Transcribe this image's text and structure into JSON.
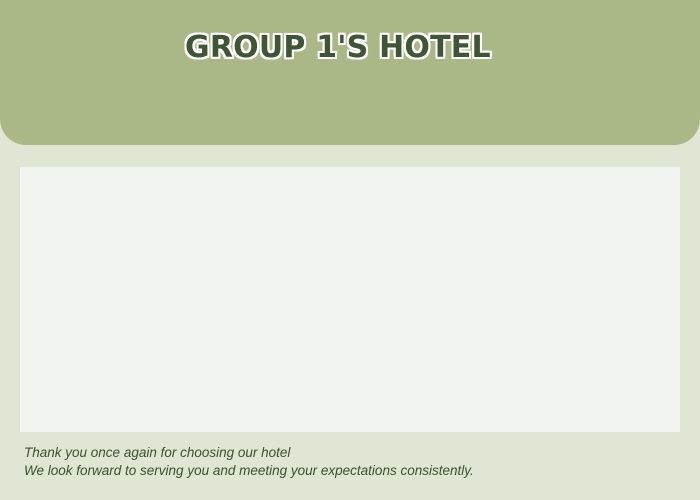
{
  "header": {
    "title": "GROUP 1'S HOTEL"
  },
  "footer": {
    "line1": "Thank you once again for choosing our hotel",
    "line2": "We look forward to serving you and meeting your expectations consistently."
  },
  "colors": {
    "page_background": "#dfe6d3",
    "header_background": "#a9b886",
    "title_text": "#3f5536",
    "panel_background": "#f2f4ef",
    "footer_text": "#3c5030"
  }
}
